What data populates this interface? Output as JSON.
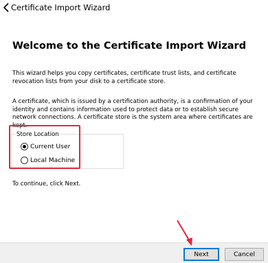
{
  "window": {
    "title": "Certificate Import Wizard"
  },
  "main": {
    "heading": "Welcome to the Certificate Import Wizard",
    "intro": "This wizard helps you copy certificates, certificate trust lists, and certificate revocation lists from your disk to a certificate store.",
    "explanation": "A certificate, which is issued by a certification authority, is a confirmation of your identity and contains information used to protect data or to establish secure network connections. A certificate store is the system area where certificates are kept.",
    "store_location": {
      "label": "Store Location",
      "options": [
        {
          "label": "Current User",
          "checked": true
        },
        {
          "label": "Local Machine",
          "checked": false
        }
      ]
    },
    "continue_text": "To continue, click Next."
  },
  "footer": {
    "next_label": "Next",
    "cancel_label": "Cancel"
  },
  "icons": {
    "back": "back-arrow-icon",
    "app": "certificate-icon"
  },
  "colors": {
    "highlight": "#e32636",
    "default_button_border": "#0078d7",
    "footer_bg": "#f0f0f0"
  }
}
